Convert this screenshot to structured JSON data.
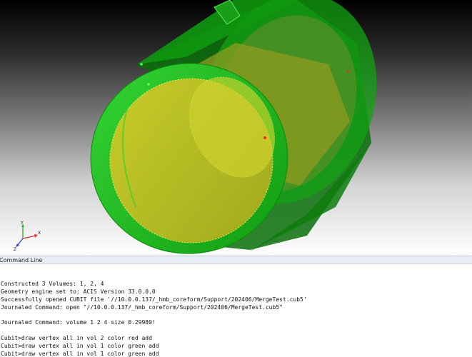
{
  "viewport": {
    "colors": {
      "shell": "#16c216",
      "shell_dark": "#0a7f0a",
      "core": "#c8cc28",
      "red_vertex": "#ff2020",
      "green_vertex": "#55ff55"
    },
    "triad": {
      "x_label": "X",
      "y_label": "Y",
      "z_label": "Z"
    }
  },
  "command_panel": {
    "title": "Command Line"
  },
  "console": {
    "lines": [
      "Constructed 3 Volumes: 1, 2, 4",
      "Geometry engine set to: ACIS Version 33.0.0.0",
      "Successfully opened CUBIT file '//10.0.0.137/_hmb_coreform/Support/202406/MergeTest.cub5'",
      "Journaled Command: open \"//10.0.0.137/_hmb_coreform/Support/202406/MergeTest.cub5\"",
      "",
      "Journaled Command: volume 1 2 4 size 0.29980!",
      "",
      "Cubit>draw vertex all in vol 2 color red add",
      "Cubit>draw vertex all in vol 1 color green add",
      "Cubit>draw vertex all in vol 1 color green add"
    ]
  }
}
